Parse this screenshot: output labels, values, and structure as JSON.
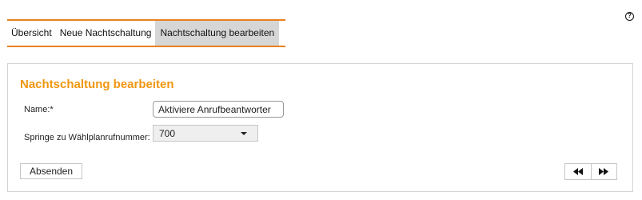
{
  "tabs": [
    {
      "label": "Übersicht",
      "active": false
    },
    {
      "label": "Neue Nachtschaltung",
      "active": false
    },
    {
      "label": "Nachtschaltung bearbeiten",
      "active": true
    }
  ],
  "help": {
    "symbol": "?",
    "icon": "help-icon"
  },
  "form": {
    "title": "Nachtschaltung bearbeiten",
    "name_label": "Name:*",
    "name_value": "Aktiviere Anrufbeantworter",
    "jump_label": "Springe zu Wählplanrufnummer:",
    "jump_value": "700",
    "submit_label": "Absenden"
  },
  "pager": {
    "prev_icon": "rewind-icon",
    "next_icon": "fast-forward-icon"
  },
  "colors": {
    "accent": "#e8821e",
    "title": "#f0960f",
    "active_tab": "#d6d6d6"
  }
}
